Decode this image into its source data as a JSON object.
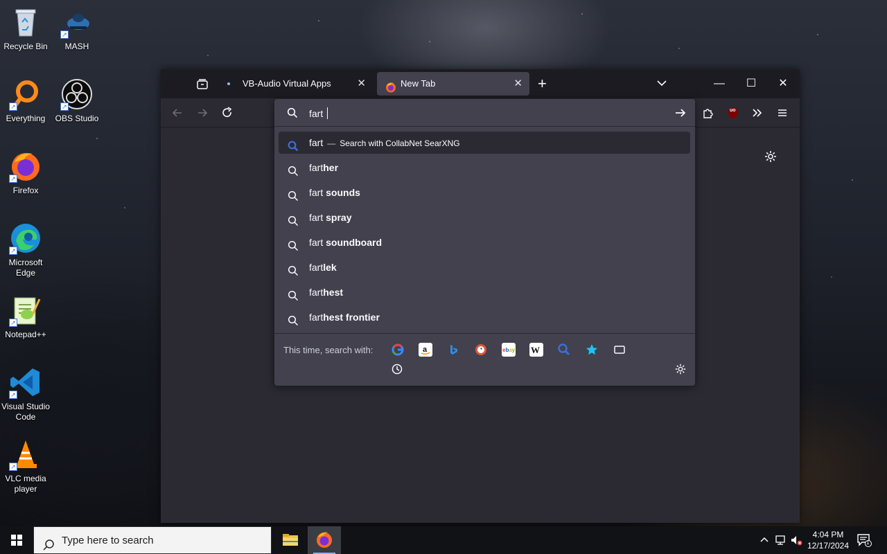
{
  "desktop": {
    "icons": [
      {
        "label": "Recycle Bin"
      },
      {
        "label": "MASH"
      },
      {
        "label": "Everything"
      },
      {
        "label": "OBS Studio"
      },
      {
        "label": "Firefox"
      },
      {
        "label": "Microsoft Edge"
      },
      {
        "label": "Notepad++"
      },
      {
        "label": "Visual Studio Code"
      },
      {
        "label": "VLC media player"
      }
    ]
  },
  "browser": {
    "tabs": [
      {
        "title": "VB-Audio Virtual Apps",
        "active": false
      },
      {
        "title": "New Tab",
        "active": true
      }
    ],
    "window_controls": {
      "minimize": "—",
      "maximize": "☐",
      "close": "✕"
    },
    "tab_close_glyph": "✕",
    "new_tab_glyph": "+",
    "urlbar": {
      "value": "fart",
      "results": [
        {
          "typed": "fart",
          "suffix": "",
          "separator": "—",
          "action": "Search with CollabNet SearXNG",
          "selected": true
        },
        {
          "typed": "fart",
          "suffix": "her"
        },
        {
          "typed": "fart ",
          "suffix": "sounds"
        },
        {
          "typed": "fart ",
          "suffix": "spray"
        },
        {
          "typed": "fart ",
          "suffix": "soundboard"
        },
        {
          "typed": "fart",
          "suffix": "lek"
        },
        {
          "typed": "fart",
          "suffix": "hest"
        },
        {
          "typed": "fart",
          "suffix": "hest frontier"
        }
      ],
      "one_off_label": "This time, search with:",
      "engines": [
        "google-icon",
        "amazon-icon",
        "bing-icon",
        "duckduckgo-icon",
        "ebay-icon",
        "wikipedia-icon",
        "searxng-icon",
        "bookmarks-icon",
        "tabs-icon"
      ]
    },
    "ublock_badge": "uo"
  },
  "taskbar": {
    "search_placeholder": "Type here to search",
    "time": "4:04 PM",
    "date": "12/17/2024",
    "notification_count": "1"
  },
  "colors": {
    "accent": "#3a6fd8",
    "panel": "#42414d",
    "toolbar": "#2b2a33",
    "titlebar": "#1c1b22"
  }
}
